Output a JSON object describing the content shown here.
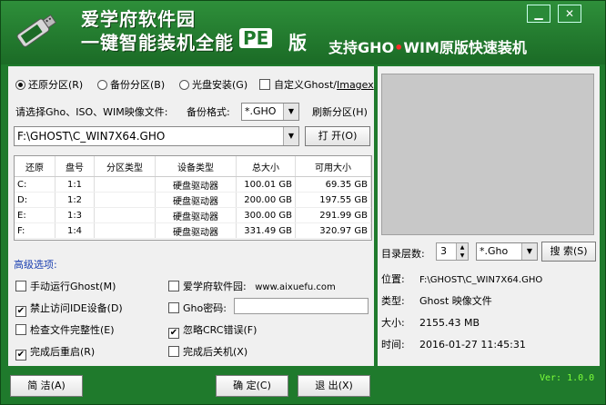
{
  "brand": {
    "line1": "爱学府软件园",
    "line2": "一键智能装机全能",
    "pe": "PE",
    "ban": "版",
    "slogan_a": "支持GHO",
    "slogan_dot": "•",
    "slogan_b": "WIM原版快速装机"
  },
  "titlebar": {
    "minimize": "▁",
    "close": "✕"
  },
  "modes": [
    {
      "label": "还原分区",
      "key": "(R)"
    },
    {
      "label": "备份分区",
      "key": "(B)"
    },
    {
      "label": "光盘安装",
      "key": "(G)"
    }
  ],
  "custom_mode": {
    "label": "自定义Ghost/",
    "key": "Imagex"
  },
  "select_image_label": "请选择Gho、ISO、WIM映像文件:",
  "backup_format_label": "备份格式:",
  "backup_format_value": "*.GHO",
  "refresh_label": "刷新分区",
  "refresh_key": "(H)",
  "image_path": "F:\\GHOST\\C_WIN7X64.GHO",
  "open_button": "打 开",
  "open_key": "(O)",
  "table": {
    "headers": [
      "还原",
      "盘号",
      "分区类型",
      "设备类型",
      "总大小",
      "可用大小"
    ],
    "rows": [
      [
        "C:",
        "1:1",
        "",
        "硬盘驱动器",
        "100.01 GB",
        "69.35 GB"
      ],
      [
        "D:",
        "1:2",
        "",
        "硬盘驱动器",
        "200.00 GB",
        "197.55 GB"
      ],
      [
        "E:",
        "1:3",
        "",
        "硬盘驱动器",
        "300.00 GB",
        "291.99 GB"
      ],
      [
        "F:",
        "1:4",
        "",
        "硬盘驱动器",
        "331.49 GB",
        "320.97 GB"
      ]
    ]
  },
  "advanced_label": "高级选项:",
  "options_left": [
    {
      "label": "手动运行Ghost",
      "key": "(M)",
      "checked": false
    },
    {
      "label": "禁止访问IDE设备",
      "key": "(D)",
      "checked": true
    },
    {
      "label": "检查文件完整性",
      "key": "(E)",
      "checked": false
    },
    {
      "label": "完成后重启",
      "key": "(R)",
      "checked": true
    }
  ],
  "options_right": [
    {
      "label": "爱学府软件园:",
      "extra": "www.aixuefu.com",
      "checked": false
    },
    {
      "label": "Gho密码:",
      "checked": false
    },
    {
      "label": "忽略CRC错误",
      "key": "(F)",
      "checked": true
    },
    {
      "label": "完成后关机",
      "key": "(X)",
      "checked": false
    }
  ],
  "dir_level_label": "目录层数:",
  "dir_level_value": "3",
  "filter_value": "*.Gho",
  "search_button": "搜 索",
  "search_key": "(S)",
  "info": {
    "position_label": "位置:",
    "position_value": "F:\\GHOST\\C_WIN7X64.GHO",
    "type_label": "类型:",
    "type_value": "Ghost 映像文件",
    "size_label": "大小:",
    "size_value": "2155.43 MB",
    "time_label": "时间:",
    "time_value": "2016-01-27 11:45:31"
  },
  "buttons": {
    "simple": "简 洁",
    "simple_key": "(A)",
    "ok": "确 定",
    "ok_key": "(C)",
    "exit": "退 出",
    "exit_key": "(X)"
  },
  "version": "Ver: 1.0.0",
  "colors": {
    "frame": "#1f7a2c",
    "accent_blue": "#1a3fb0",
    "version": "#7dff3a"
  }
}
